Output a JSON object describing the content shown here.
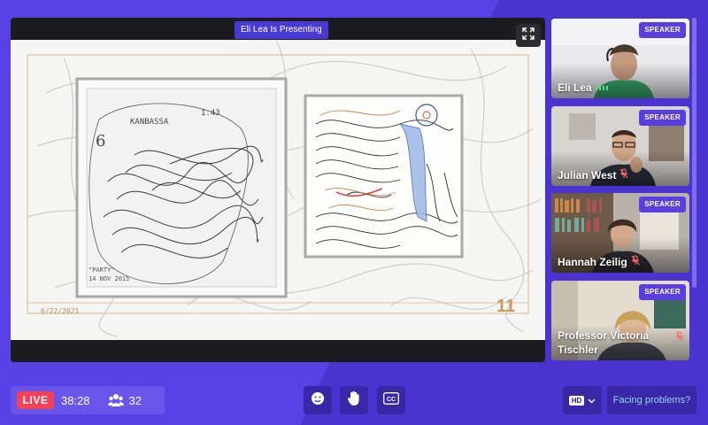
{
  "presentation": {
    "presenter_banner": "Eli Lea Is Presenting",
    "slide_date": "6/22/2021",
    "slide_number": "11"
  },
  "participants": [
    {
      "name": "Eli Lea",
      "badge": "SPEAKER",
      "mic": "speaking"
    },
    {
      "name": "Julian West",
      "badge": "SPEAKER",
      "mic": "muted"
    },
    {
      "name": "Hannah Zeilig",
      "badge": "SPEAKER",
      "mic": "muted"
    },
    {
      "name": "Professor Victoria Tischler",
      "badge": "SPEAKER",
      "mic": "muted"
    }
  ],
  "footer": {
    "live_label": "LIVE",
    "elapsed": "38:28",
    "viewer_count": "32",
    "quality": "HD",
    "help_label": "Facing problems?"
  },
  "icons": {
    "fullscreen": "expand-icon",
    "emoji": "smiley-icon",
    "raise_hand": "hand-icon",
    "captions": "cc-icon",
    "viewers": "people-icon",
    "mic_muted": "mic-muted-icon",
    "audio_level": "audio-level-icon"
  },
  "colors": {
    "accent": "#5a3fe0",
    "live": "#f0435a",
    "help_text": "#8fd6ff",
    "slide_number": "#c99a5f"
  }
}
